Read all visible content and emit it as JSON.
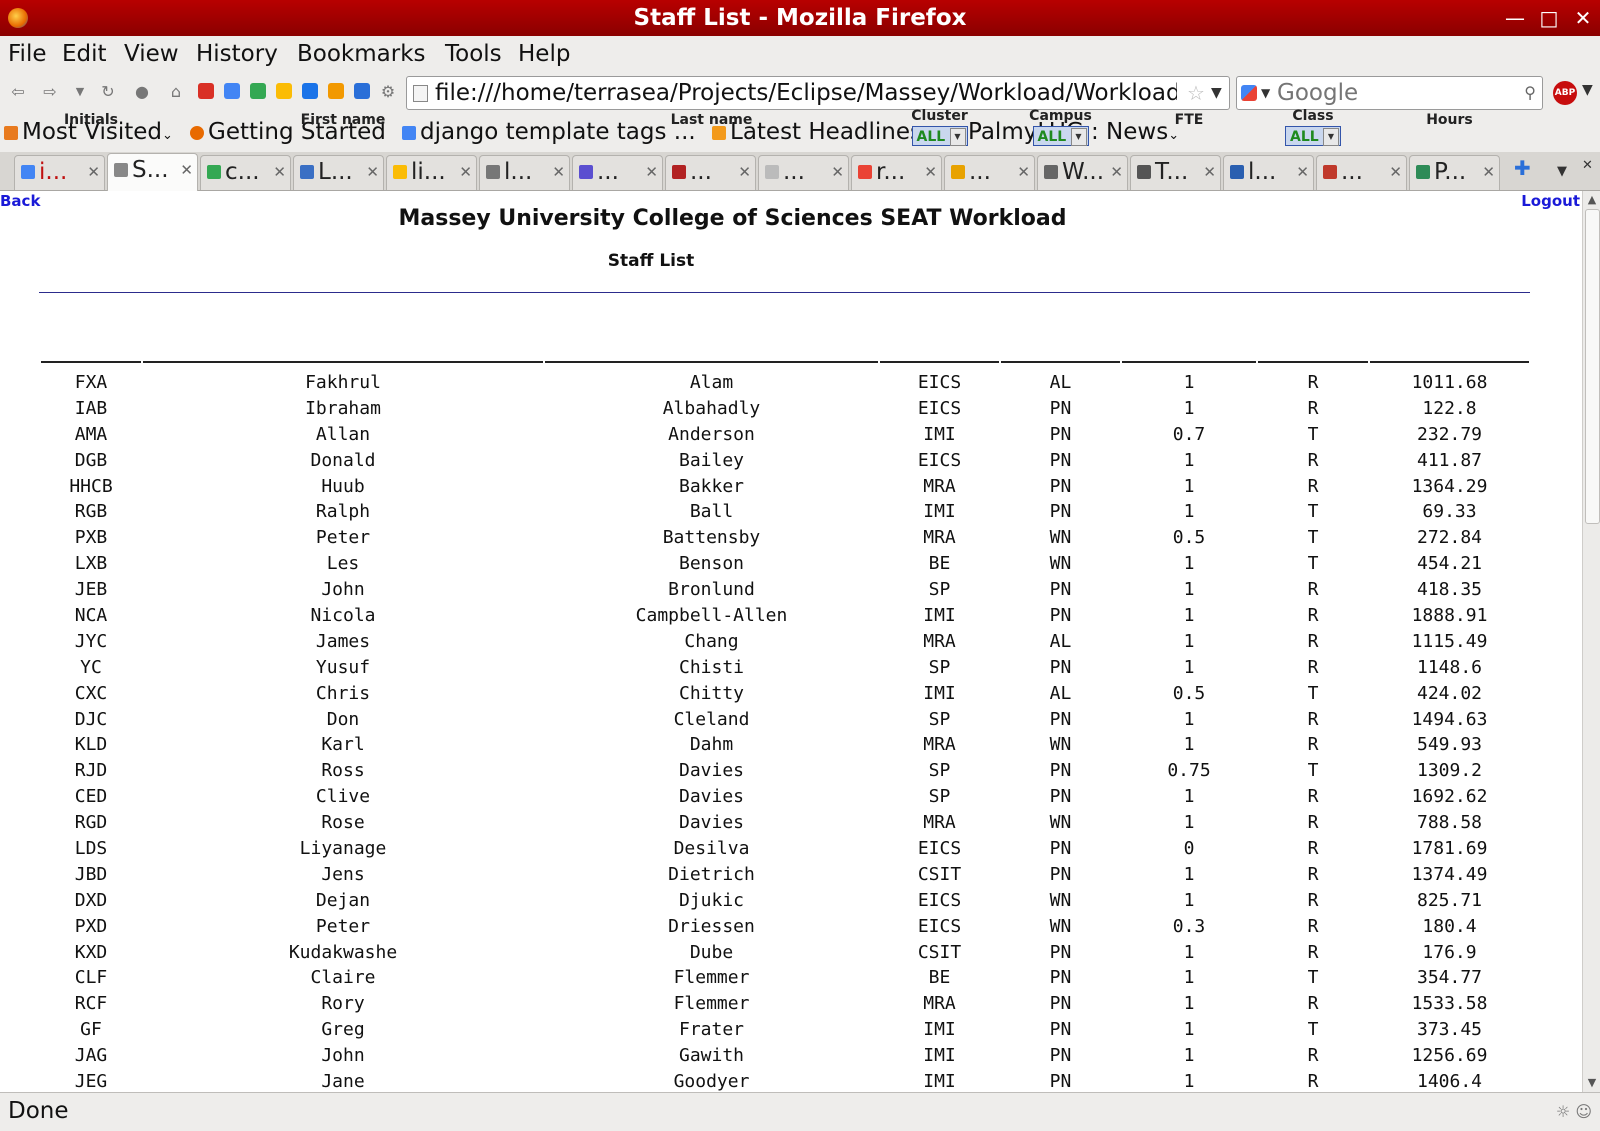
{
  "window": {
    "title": "Staff List - Mozilla Firefox"
  },
  "menu": {
    "file": "File",
    "edit": "Edit",
    "view": "View",
    "history": "History",
    "bookmarks": "Bookmarks",
    "tools": "Tools",
    "help": "Help"
  },
  "nav": {
    "url": "file:///home/terrasea/Projects/Eclipse/Massey/Workload/Workload",
    "search_placeholder": "Google"
  },
  "bookmarks": [
    {
      "label": "Most Visited",
      "color": "#e87a1e"
    },
    {
      "label": "Getting Started",
      "color": "#e86a00"
    },
    {
      "label": "django template tags ...",
      "color": "#4285f4"
    },
    {
      "label": "Latest Headlines",
      "color": "#f39a1b"
    },
    {
      "label": "PalmyLUG : News",
      "color": "#f39a1b"
    }
  ],
  "tabs": [
    {
      "label": "i...",
      "color": "#4285f4"
    },
    {
      "label": "S...",
      "color": "#888888"
    },
    {
      "label": "c...",
      "color": "#34a853"
    },
    {
      "label": "L...",
      "color": "#3a6fc4"
    },
    {
      "label": "li...",
      "color": "#fbbc05"
    },
    {
      "label": "l...",
      "color": "#777777"
    },
    {
      "label": "...",
      "color": "#5b4fd0"
    },
    {
      "label": "...",
      "color": "#b22222"
    },
    {
      "label": "...",
      "color": "#bbbbbb"
    },
    {
      "label": "r...",
      "color": "#ea4335"
    },
    {
      "label": "...",
      "color": "#e8a200"
    },
    {
      "label": "W...",
      "color": "#666666"
    },
    {
      "label": "T...",
      "color": "#555555"
    },
    {
      "label": "l...",
      "color": "#2a5fb0"
    },
    {
      "label": "...",
      "color": "#c0392b"
    },
    {
      "label": "P...",
      "color": "#2e8b57"
    }
  ],
  "page": {
    "back": "Back",
    "logout": "Logout",
    "title": "Massey University College of Sciences SEAT Workload",
    "subtitle": "Staff List"
  },
  "table": {
    "headers": {
      "initials": "Initials",
      "first_name": "First name",
      "last_name": "Last name",
      "cluster": "Cluster",
      "campus": "Campus",
      "fte": "FTE",
      "class": "Class",
      "hours": "Hours"
    },
    "filters": {
      "cluster": "ALL",
      "campus": "ALL",
      "class": "ALL"
    },
    "rows": [
      [
        "FXA",
        "Fakhrul",
        "Alam",
        "EICS",
        "AL",
        "1",
        "R",
        "1011.68"
      ],
      [
        "IAB",
        "Ibraham",
        "Albahadly",
        "EICS",
        "PN",
        "1",
        "R",
        "122.8"
      ],
      [
        "AMA",
        "Allan",
        "Anderson",
        "IMI",
        "PN",
        "0.7",
        "T",
        "232.79"
      ],
      [
        "DGB",
        "Donald",
        "Bailey",
        "EICS",
        "PN",
        "1",
        "R",
        "411.87"
      ],
      [
        "HHCB",
        "Huub",
        "Bakker",
        "MRA",
        "PN",
        "1",
        "R",
        "1364.29"
      ],
      [
        "RGB",
        "Ralph",
        "Ball",
        "IMI",
        "PN",
        "1",
        "T",
        "69.33"
      ],
      [
        "PXB",
        "Peter",
        "Battensby",
        "MRA",
        "WN",
        "0.5",
        "T",
        "272.84"
      ],
      [
        "LXB",
        "Les",
        "Benson",
        "BE",
        "WN",
        "1",
        "T",
        "454.21"
      ],
      [
        "JEB",
        "John",
        "Bronlund",
        "SP",
        "PN",
        "1",
        "R",
        "418.35"
      ],
      [
        "NCA",
        "Nicola",
        "Campbell-Allen",
        "IMI",
        "PN",
        "1",
        "R",
        "1888.91"
      ],
      [
        "JYC",
        "James",
        "Chang",
        "MRA",
        "AL",
        "1",
        "R",
        "1115.49"
      ],
      [
        "YC",
        "Yusuf",
        "Chisti",
        "SP",
        "PN",
        "1",
        "R",
        "1148.6"
      ],
      [
        "CXC",
        "Chris",
        "Chitty",
        "IMI",
        "AL",
        "0.5",
        "T",
        "424.02"
      ],
      [
        "DJC",
        "Don",
        "Cleland",
        "SP",
        "PN",
        "1",
        "R",
        "1494.63"
      ],
      [
        "KLD",
        "Karl",
        "Dahm",
        "MRA",
        "WN",
        "1",
        "R",
        "549.93"
      ],
      [
        "RJD",
        "Ross",
        "Davies",
        "SP",
        "PN",
        "0.75",
        "T",
        "1309.2"
      ],
      [
        "CED",
        "Clive",
        "Davies",
        "SP",
        "PN",
        "1",
        "R",
        "1692.62"
      ],
      [
        "RGD",
        "Rose",
        "Davies",
        "MRA",
        "WN",
        "1",
        "R",
        "788.58"
      ],
      [
        "LDS",
        "Liyanage",
        "Desilva",
        "EICS",
        "PN",
        "0",
        "R",
        "1781.69"
      ],
      [
        "JBD",
        "Jens",
        "Dietrich",
        "CSIT",
        "PN",
        "1",
        "R",
        "1374.49"
      ],
      [
        "DXD",
        "Dejan",
        "Djukic",
        "EICS",
        "WN",
        "1",
        "R",
        "825.71"
      ],
      [
        "PXD",
        "Peter",
        "Driessen",
        "EICS",
        "WN",
        "0.3",
        "R",
        "180.4"
      ],
      [
        "KXD",
        "Kudakwashe",
        "Dube",
        "CSIT",
        "PN",
        "1",
        "R",
        "176.9"
      ],
      [
        "CLF",
        "Claire",
        "Flemmer",
        "BE",
        "PN",
        "1",
        "T",
        "354.77"
      ],
      [
        "RCF",
        "Rory",
        "Flemmer",
        "MRA",
        "PN",
        "1",
        "R",
        "1533.58"
      ],
      [
        "GF",
        "Greg",
        "Frater",
        "IMI",
        "PN",
        "1",
        "T",
        "373.45"
      ],
      [
        "JAG",
        "John",
        "Gawith",
        "IMI",
        "PN",
        "1",
        "R",
        "1256.69"
      ],
      [
        "JEG",
        "Jane",
        "Goodyer",
        "IMI",
        "PN",
        "1",
        "R",
        "1406.4"
      ]
    ]
  },
  "status": {
    "text": "Done"
  }
}
